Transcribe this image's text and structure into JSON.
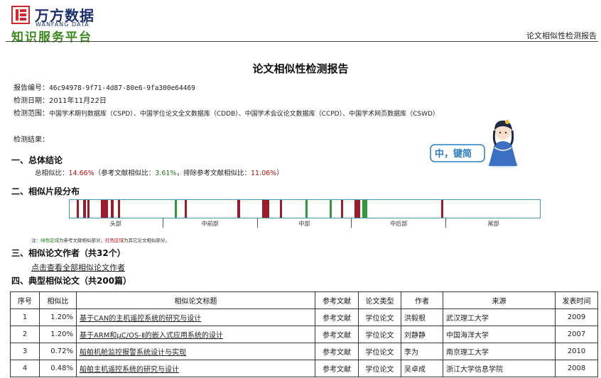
{
  "brand": {
    "name_cn": "万方数据",
    "name_en": "WANFANG DATA",
    "subtitle": "知识服务平台"
  },
  "header": {
    "right_title": "论文相似性检测报告"
  },
  "report": {
    "title": "论文相似性检测报告",
    "id_label": "报告编号：",
    "id_value": "46c94978-9f71-4d87-80e6-9fa300e64469",
    "date_label": "检测日期：",
    "date_value": "2011年11月22日",
    "scope_label": "检测范围：",
    "scope_value": "中国学术期刊数据库（CSPD）、中国学位论文全文数据库（CDDB）、中国学术会议论文数据库（CCPD）、中国学术网页数据库（CSWD）",
    "result_label": "检测结果："
  },
  "mascot": {
    "text": "中，键简"
  },
  "section1": {
    "heading": "一、总体结论",
    "total_label": "总相似比：",
    "total_value": "14.66%",
    "ref_label": "（参考文献相似比：",
    "ref_value": "3.61%",
    "excl_label": "，排除参考文献相似比：",
    "excl_value": "11.06%",
    "close": "）"
  },
  "section2": {
    "heading": "二、相似片段分布",
    "bar_colors": {
      "red": "#9e1b2c",
      "green": "#2e9a3a"
    },
    "segments": [
      {
        "start": 0.015,
        "end": 0.02,
        "type": "red"
      },
      {
        "start": 0.028,
        "end": 0.034,
        "type": "red"
      },
      {
        "start": 0.038,
        "end": 0.043,
        "type": "red"
      },
      {
        "start": 0.066,
        "end": 0.082,
        "type": "red"
      },
      {
        "start": 0.088,
        "end": 0.094,
        "type": "red"
      },
      {
        "start": 0.103,
        "end": 0.107,
        "type": "red"
      },
      {
        "start": 0.223,
        "end": 0.228,
        "type": "green"
      },
      {
        "start": 0.245,
        "end": 0.25,
        "type": "red"
      },
      {
        "start": 0.356,
        "end": 0.362,
        "type": "red"
      },
      {
        "start": 0.41,
        "end": 0.424,
        "type": "red"
      },
      {
        "start": 0.447,
        "end": 0.452,
        "type": "red"
      },
      {
        "start": 0.502,
        "end": 0.506,
        "type": "green"
      },
      {
        "start": 0.553,
        "end": 0.558,
        "type": "green"
      },
      {
        "start": 0.577,
        "end": 0.581,
        "type": "red"
      },
      {
        "start": 0.605,
        "end": 0.618,
        "type": "red"
      },
      {
        "start": 0.623,
        "end": 0.628,
        "type": "green"
      },
      {
        "start": 0.629,
        "end": 0.633,
        "type": "green"
      },
      {
        "start": 0.79,
        "end": 0.795,
        "type": "red"
      }
    ],
    "parts": [
      "头部",
      "中前部",
      "中部",
      "中后部",
      "尾部"
    ],
    "note_prefix": "注：",
    "note_green": "绿色区域",
    "note_mid": "为参考文献相似部分，",
    "note_red": "红色区域",
    "note_end": "为其它论文相似部分。"
  },
  "section3": {
    "heading": "三、相似论文作者（共32个）",
    "link": "点击查看全部相似论文作者"
  },
  "section4": {
    "heading": "四、典型相似论文（共200篇）",
    "columns": [
      "序号",
      "相似比",
      "相似论文标题",
      "参考文献",
      "论文类型",
      "作者",
      "来源",
      "发表时间"
    ],
    "rows": [
      {
        "no": "1",
        "ratio": "1.20%",
        "title": "基于CAN的主机遥控系统的研究与设计",
        "ref": "参考文献",
        "type": "学位论文",
        "author": "洪毅根",
        "source": "武汉理工大学",
        "year": "2009"
      },
      {
        "no": "2",
        "ratio": "1.20%",
        "title": "基于ARM和μC/OS-Ⅱ的嵌入式应用系统的设计",
        "ref": "参考文献",
        "type": "学位论文",
        "author": "刘静静",
        "source": "中国海洋大学",
        "year": "2007"
      },
      {
        "no": "3",
        "ratio": "0.72%",
        "title": "船舶机舱监控报警系统设计与实现",
        "ref": "参考文献",
        "type": "学位论文",
        "author": "李为",
        "source": "南京理工大学",
        "year": "2010"
      },
      {
        "no": "4",
        "ratio": "0.48%",
        "title": "船舶主机遥控系统的研究与设计",
        "ref": "参考文献",
        "type": "学位论文",
        "author": "吴卓成",
        "source": "浙江大学信息学院",
        "year": "2008"
      }
    ]
  }
}
